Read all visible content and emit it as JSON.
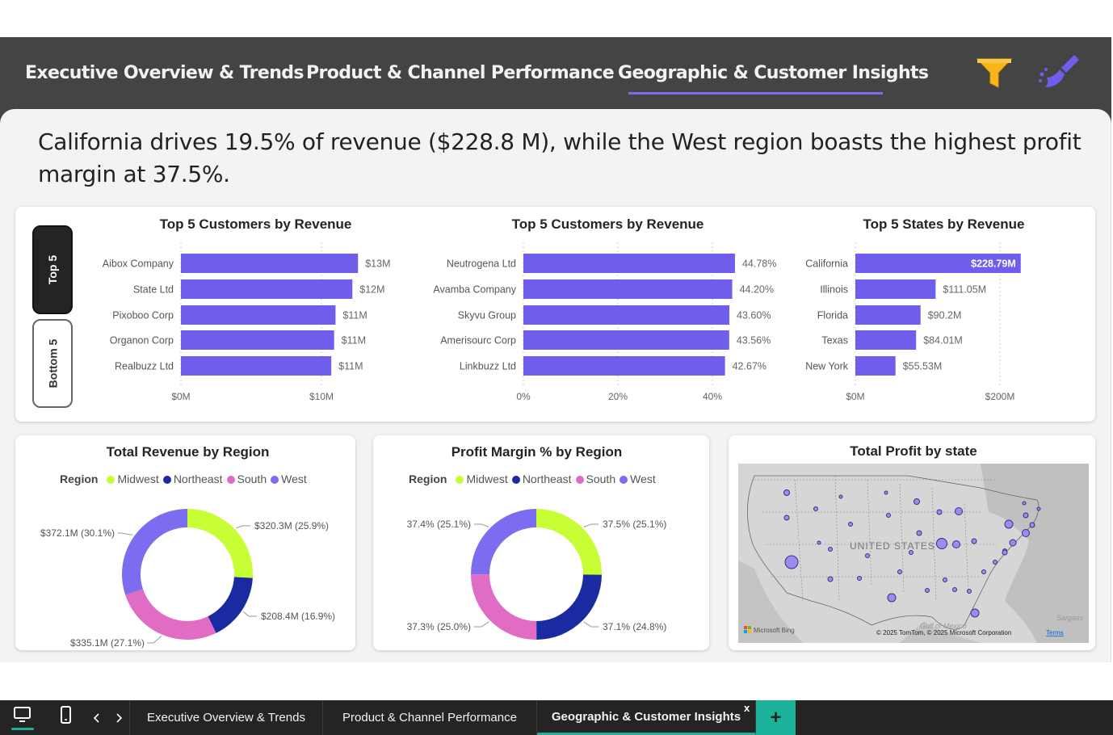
{
  "nav": {
    "tabs": [
      {
        "label": "Executive Overview & Trends"
      },
      {
        "label": "Product & Channel Performance"
      },
      {
        "label": "Geographic & Customer Insights"
      }
    ],
    "active_tab": "Geographic & Customer Insights",
    "icons": [
      "filter-icon",
      "clear-filters-icon"
    ]
  },
  "headline": "California drives 19.5% of revenue ($228.8 M), while the West region boasts the highest profit margin at 37.5%.",
  "toggle": {
    "top": "Top 5",
    "bottom": "Bottom 5"
  },
  "colors": {
    "accent": "#6e5eeb",
    "midwest": "#c6ff33",
    "northeast": "#1a2aa0",
    "south": "#e06cc4",
    "west": "#7b6cf0"
  },
  "chart_data": [
    {
      "type": "bar",
      "orientation": "horizontal",
      "title": "Top 5 Customers by Revenue",
      "categories": [
        "Aibox Company",
        "State Ltd",
        "Pixoboo Corp",
        "Organon Corp",
        "Realbuzz Ltd"
      ],
      "values": [
        12.6,
        12.2,
        11.0,
        10.9,
        10.7
      ],
      "labels": [
        "$13M",
        "$12M",
        "$11M",
        "$11M",
        "$11M"
      ],
      "xticks": [
        "$0M",
        "$10M"
      ],
      "xlim": [
        0,
        17
      ]
    },
    {
      "type": "bar",
      "orientation": "horizontal",
      "title": "Top 5 Customers by Revenue",
      "categories": [
        "Neutrogena Ltd",
        "Avamba Company",
        "Skyvu Group",
        "Amerisourc Corp",
        "Linkbuzz Ltd"
      ],
      "values": [
        44.78,
        44.2,
        43.6,
        43.56,
        42.67
      ],
      "labels": [
        "44.78%",
        "44.20%",
        "43.60%",
        "43.56%",
        "42.67%"
      ],
      "xticks": [
        "0%",
        "20%",
        "40%"
      ],
      "xlim": [
        0,
        48
      ]
    },
    {
      "type": "bar",
      "orientation": "horizontal",
      "title": "Top 5 States by Revenue",
      "categories": [
        "California",
        "Illinois",
        "Florida",
        "Texas",
        "New York"
      ],
      "values": [
        228.79,
        111.05,
        90.2,
        84.01,
        55.53
      ],
      "labels": [
        "$228.79M",
        "$111.05M",
        "$90.2M",
        "$84.01M",
        "$55.53M"
      ],
      "xticks": [
        "$0M",
        "$200M"
      ],
      "xlim": [
        0,
        230
      ]
    },
    {
      "type": "pie",
      "donut": true,
      "title": "Total Revenue by Region",
      "legend_title": "Region",
      "categories": [
        "Midwest",
        "Northeast",
        "South",
        "West"
      ],
      "values": [
        320.3,
        208.4,
        335.1,
        372.1
      ],
      "labels": [
        "$320.3M (25.9%)",
        "$208.4M (16.9%)",
        "$335.1M (27.1%)",
        "$372.1M (30.1%)"
      ]
    },
    {
      "type": "pie",
      "donut": true,
      "title": "Profit Margin % by Region",
      "legend_title": "Region",
      "categories": [
        "Midwest",
        "Northeast",
        "South",
        "West"
      ],
      "values": [
        37.5,
        37.1,
        37.3,
        37.4
      ],
      "labels": [
        "37.5% (25.1%)",
        "37.1% (24.8%)",
        "37.3% (25.0%)",
        "37.4% (25.1%)"
      ]
    }
  ],
  "map": {
    "title": "Total Profit by state",
    "country_label": "UNITED STATES",
    "sea_label": "Sargass",
    "gulf_label": "Gulf of Mexico",
    "attribution_left": "Microsoft Bing",
    "attribution_right": "© 2025 TomTom, © 2025 Microsoft Corporation",
    "terms": "Terms"
  },
  "bottom_tabs": [
    "Executive Overview & Trends",
    "Product & Channel Performance",
    "Geographic & Customer Insights"
  ],
  "add_tab": "+",
  "close_tab": "x"
}
